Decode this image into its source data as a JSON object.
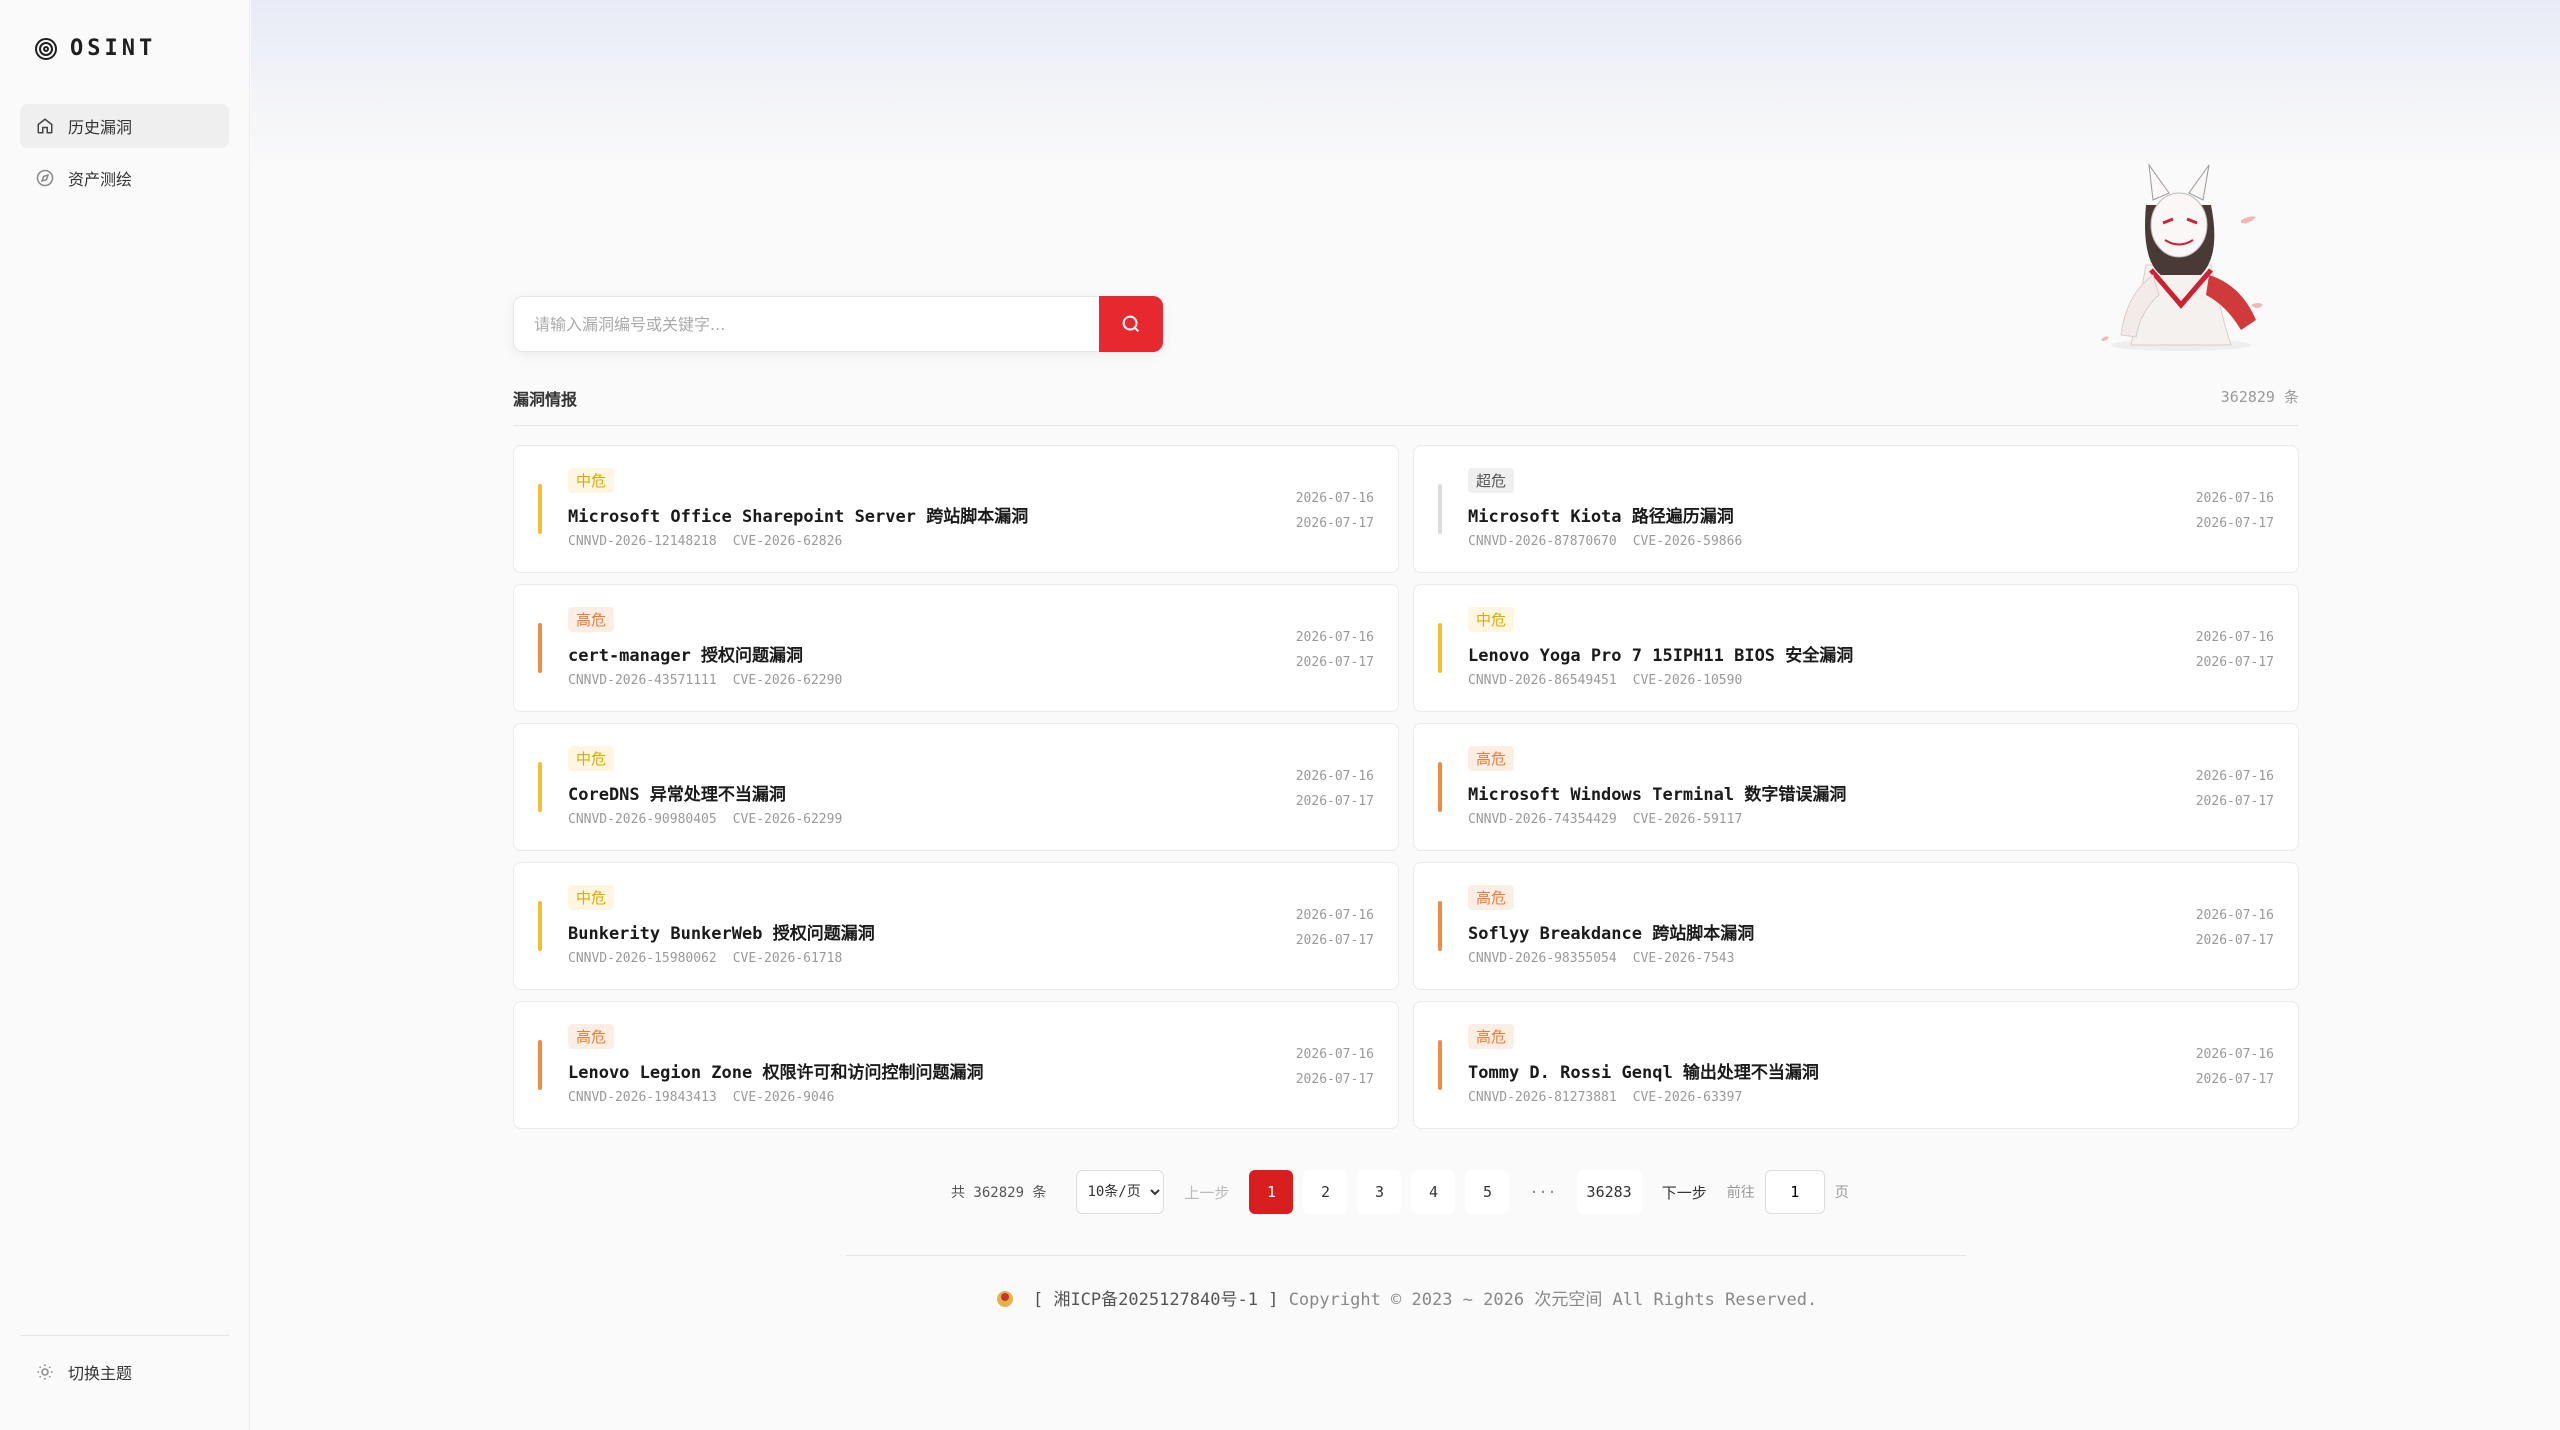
{
  "sidebar": {
    "logo": "OSINT",
    "items": [
      {
        "label": "历史漏洞",
        "icon": "home-icon"
      },
      {
        "label": "资产测绘",
        "icon": "compass-icon"
      }
    ],
    "theme_toggle": "切换主题"
  },
  "search": {
    "placeholder": "请输入漏洞编号或关键字..."
  },
  "section": {
    "title": "漏洞情报",
    "count": "362829 条"
  },
  "vulns": [
    {
      "level": "中危",
      "title": "Microsoft Office Sharepoint Server 跨站脚本漏洞",
      "cnnvd": "CNNVD-2026-12148218",
      "cve": "CVE-2026-62826",
      "date1": "2026-07-16",
      "date2": "2026-07-17"
    },
    {
      "level": "超危",
      "title": "Microsoft Kiota 路径遍历漏洞",
      "cnnvd": "CNNVD-2026-87870670",
      "cve": "CVE-2026-59866",
      "date1": "2026-07-16",
      "date2": "2026-07-17"
    },
    {
      "level": "高危",
      "title": "cert-manager 授权问题漏洞",
      "cnnvd": "CNNVD-2026-43571111",
      "cve": "CVE-2026-62290",
      "date1": "2026-07-16",
      "date2": "2026-07-17"
    },
    {
      "level": "中危",
      "title": "Lenovo Yoga Pro 7 15IPH11 BIOS 安全漏洞",
      "cnnvd": "CNNVD-2026-86549451",
      "cve": "CVE-2026-10590",
      "date1": "2026-07-16",
      "date2": "2026-07-17"
    },
    {
      "level": "中危",
      "title": "CoreDNS 异常处理不当漏洞",
      "cnnvd": "CNNVD-2026-90980405",
      "cve": "CVE-2026-62299",
      "date1": "2026-07-16",
      "date2": "2026-07-17"
    },
    {
      "level": "高危",
      "title": "Microsoft Windows Terminal 数字错误漏洞",
      "cnnvd": "CNNVD-2026-74354429",
      "cve": "CVE-2026-59117",
      "date1": "2026-07-16",
      "date2": "2026-07-17"
    },
    {
      "level": "中危",
      "title": "Bunkerity BunkerWeb 授权问题漏洞",
      "cnnvd": "CNNVD-2026-15980062",
      "cve": "CVE-2026-61718",
      "date1": "2026-07-16",
      "date2": "2026-07-17"
    },
    {
      "level": "高危",
      "title": "Soflyy Breakdance 跨站脚本漏洞",
      "cnnvd": "CNNVD-2026-98355054",
      "cve": "CVE-2026-7543",
      "date1": "2026-07-16",
      "date2": "2026-07-17"
    },
    {
      "level": "高危",
      "title": "Lenovo Legion Zone 权限许可和访问控制问题漏洞",
      "cnnvd": "CNNVD-2026-19843413",
      "cve": "CVE-2026-9046",
      "date1": "2026-07-16",
      "date2": "2026-07-17"
    },
    {
      "level": "高危",
      "title": "Tommy D. Rossi Genql 输出处理不当漏洞",
      "cnnvd": "CNNVD-2026-81273881",
      "cve": "CVE-2026-63397",
      "date1": "2026-07-16",
      "date2": "2026-07-17"
    }
  ],
  "pagination": {
    "total": "共 362829 条",
    "page_size": "10条/页",
    "prev": "上一步",
    "pages": [
      "1",
      "2",
      "3",
      "4",
      "5"
    ],
    "dots": "···",
    "last": "36283",
    "next": "下一步",
    "goto_label": "前往",
    "goto_value": "1",
    "goto_suffix": "页"
  },
  "footer": {
    "icp": "[ 湘ICP备2025127840号-1 ]",
    "copyright": "Copyright © 2023 ~ 2026 次元空间 All Rights Reserved."
  },
  "colors": {
    "accent": "#e5292e",
    "mid": "#f0c12a",
    "high": "#f08a47",
    "crit": "#dcdcdc"
  }
}
